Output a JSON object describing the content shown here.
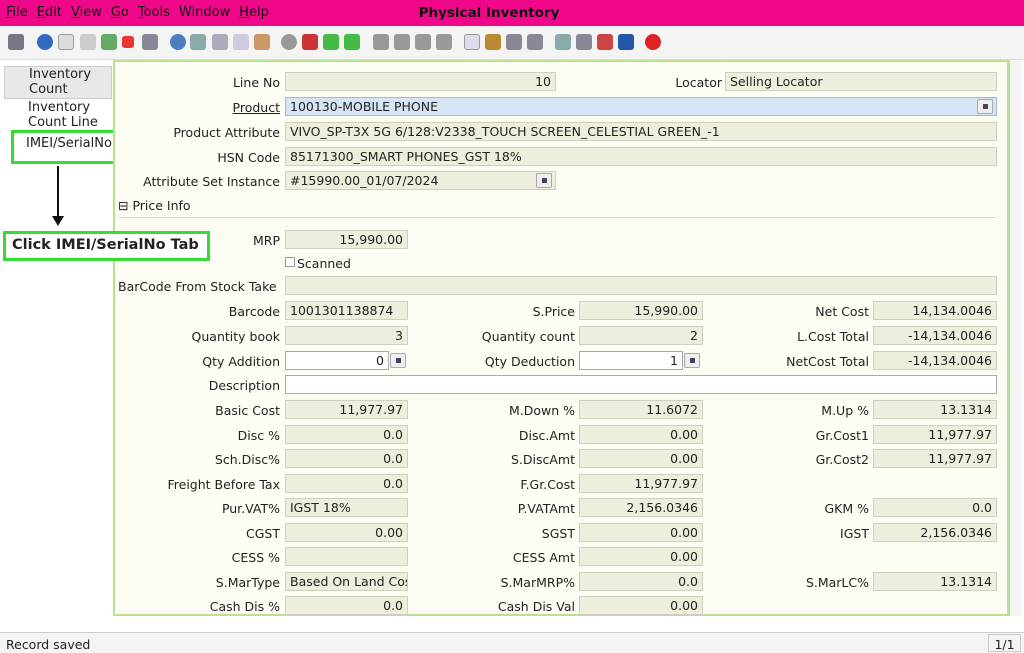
{
  "menu": [
    {
      "u": "F",
      "rest": "ile"
    },
    {
      "u": "E",
      "rest": "dit"
    },
    {
      "u": "V",
      "rest": "iew"
    },
    {
      "u": "G",
      "rest": "o"
    },
    {
      "u": "T",
      "rest": "ools"
    },
    {
      "u": "",
      "rest": "Window"
    },
    {
      "u": "H",
      "rest": "elp"
    }
  ],
  "window_title": "Physical Inventory",
  "tabs": {
    "inventory_count": "Inventory Count",
    "inventory_count_line": "Inventory Count Line",
    "imei_serial": "IMEI/SerialNo"
  },
  "annotation": "Click IMEI/SerialNo Tab",
  "form": {
    "line_no_label": "Line No",
    "line_no": "10",
    "locator_label": "Locator",
    "locator": "Selling Locator",
    "product_label": "Product",
    "product": "100130-MOBILE PHONE",
    "product_attr_label": "Product Attribute",
    "product_attr": "VIVO_SP-T3X 5G 6/128:V2338_TOUCH SCREEN_CELESTIAL GREEN_-1",
    "hsn_label": "HSN Code",
    "hsn": "85171300_SMART PHONES_GST 18%",
    "asi_label": "Attribute Set Instance",
    "asi": "#15990.00_01/07/2024",
    "price_info": "Price Info",
    "mrp_label": "MRP",
    "mrp": "15,990.00",
    "scanned_label": "Scanned",
    "barcode_stock_label": "BarCode From Stock Take",
    "barcode_label": "Barcode",
    "barcode": "1001301138874",
    "sprice_label": "S.Price",
    "sprice": "15,990.00",
    "netcost_label": "Net Cost",
    "netcost": "14,134.0046",
    "qtybook_label": "Quantity book",
    "qtybook": "3",
    "qtycount_label": "Quantity count",
    "qtycount": "2",
    "lcost_label": "L.Cost Total",
    "lcost": "-14,134.0046",
    "qtyadd_label": "Qty Addition",
    "qtyadd": "0",
    "qtyded_label": "Qty Deduction",
    "qtyded": "1",
    "netcosttotal_label": "NetCost Total",
    "netcosttotal": "-14,134.0046",
    "desc_label": "Description",
    "basiccost_label": "Basic Cost",
    "basiccost": "11,977.97",
    "mdown_label": "M.Down %",
    "mdown": "11.6072",
    "mup_label": "M.Up %",
    "mup": "13.1314",
    "disc_label": "Disc %",
    "disc": "0.0",
    "discamt_label": "Disc.Amt",
    "discamt": "0.00",
    "grcost1_label": "Gr.Cost1",
    "grcost1": "11,977.97",
    "schdisc_label": "Sch.Disc%",
    "schdisc": "0.0",
    "sdiscamt_label": "S.DiscAmt",
    "sdiscamt": "0.00",
    "grcost2_label": "Gr.Cost2",
    "grcost2": "11,977.97",
    "freight_label": "Freight Before Tax",
    "freight": "0.0",
    "fgrcost_label": "F.Gr.Cost",
    "fgrcost": "11,977.97",
    "purvat_label": "Pur.VAT%",
    "purvat": "IGST 18%",
    "pvatamt_label": "P.VATAmt",
    "pvatamt": "2,156.0346",
    "gkm_label": "GKM %",
    "gkm": "0.0",
    "cgst_label": "CGST",
    "cgst": "0.00",
    "sgst_label": "SGST",
    "sgst": "0.00",
    "igst_label": "IGST",
    "igst": "2,156.0346",
    "cess_label": "CESS %",
    "cessamt_label": "CESS Amt",
    "cessamt": "0.00",
    "smartype_label": "S.MarType",
    "smartype": "Based On Land Cost",
    "smarmrp_label": "S.MarMRP%",
    "smarmrp": "0.0",
    "smarlc_label": "S.MarLC%",
    "smarlc": "13.1314",
    "cashdis_label": "Cash Dis %",
    "cashdis": "0.0",
    "cashdisval_label": "Cash Dis Val",
    "cashdisval": "0.00"
  },
  "status": {
    "text": "Record saved",
    "page": "1/1"
  },
  "colors": {
    "titlebar": "#f0078a",
    "highlight": "#33dd33"
  }
}
